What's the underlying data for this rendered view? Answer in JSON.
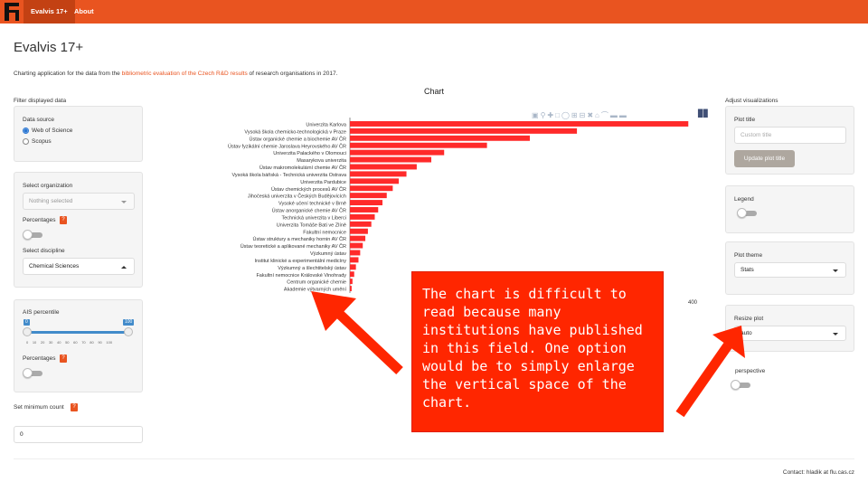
{
  "navbar": {
    "logo_letter": "F",
    "tabs": [
      {
        "label": "Evalvis 17+"
      },
      {
        "label": "About"
      }
    ],
    "color": "#e95420",
    "active_color": "#c34113"
  },
  "page": {
    "title": "Evalvis 17+",
    "intro_before": "Charting application for the data from the ",
    "intro_link": "bibliometric evaluation of the Czech R&D results",
    "intro_after": " of research organisations in 2017."
  },
  "filters": {
    "heading": "Filter displayed data",
    "data_source": {
      "label": "Data source",
      "options": [
        "Web of Science",
        "Scopus"
      ],
      "selected": "Web of Science"
    },
    "organization": {
      "label": "Select organization",
      "placeholder": "Nothing selected"
    },
    "percentages_label": "Percentages",
    "help_glyph": "?",
    "discipline": {
      "label": "Select discipline",
      "value": "Chemical Sciences"
    },
    "ais": {
      "label": "AIS percentile",
      "min": "0",
      "max": "100",
      "ticks": "0 10 20 30 40 50 60 70 80 90 100"
    },
    "percentages2_label": "Percentages",
    "min_count": {
      "label": "Set minimum count",
      "value": "0"
    }
  },
  "chart": {
    "title": "Chart",
    "modebar_icons": [
      "camera-icon",
      "zoom-icon",
      "pan-icon",
      "box-select-icon",
      "lasso-icon",
      "zoom-in-icon",
      "zoom-out-icon",
      "autoscale-icon",
      "reset-axes-icon",
      "spike-lines-icon",
      "hover-closest-icon",
      "hover-compare-icon",
      "plotly-logo-icon"
    ]
  },
  "chart_data": {
    "type": "bar",
    "orientation": "horizontal",
    "title": "",
    "xlabel": "",
    "ylabel": "",
    "xlim": [
      0,
      400
    ],
    "x_tick_labels": [
      "400"
    ],
    "bar_color": "#ff2a2a",
    "categories": [
      "Univerzita Karlova",
      "Vysoká škola chemicko-technologická v Praze",
      "Ústav organické chemie a biochemie AV ČR",
      "Ústav fyzikální chemie Jaroslava Heyrovského AV ČR",
      "Univerzita Palackého v Olomouci",
      "Masarykova univerzita",
      "Ústav makromolekulární chemie AV ČR",
      "Vysoká škola báňská - Technická univerzita Ostrava",
      "Univerzita Pardubice",
      "Ústav chemických procesů AV ČR",
      "Jihočeská univerzita v Českých Budějovicích",
      "Vysoké učení technické v Brně",
      "Ústav anorganické chemie AV ČR",
      "Technická univerzita v Liberci",
      "Univerzita Tomáše Bati ve Zlíně",
      "Fakultní nemocnice",
      "Ústav struktury a mechaniky hornin AV ČR",
      "Ústav teoretické a aplikované mechaniky AV ČR",
      "Výzkumný ústav",
      "Institut klinické a experimentální medicíny",
      "Výzkumný a šlechtitelský ústav",
      "Fakultní nemocnice Královské Vinohrady",
      "Centrum organické chemie",
      "Akademie výtvarných umění"
    ],
    "values": [
      395,
      265,
      210,
      160,
      110,
      95,
      78,
      66,
      57,
      50,
      43,
      38,
      33,
      29,
      25,
      21,
      18,
      15,
      12,
      10,
      7,
      5,
      3,
      2
    ]
  },
  "adjust": {
    "heading": "Adjust visualizations",
    "plot_title": {
      "label": "Plot title",
      "placeholder": "Custom title",
      "button": "Update plot title"
    },
    "legend_label": "Legend",
    "theme": {
      "label": "Plot theme",
      "value": "Stats"
    },
    "resize": {
      "label": "Resize plot",
      "value": "auto"
    },
    "perspective_label": "perspective"
  },
  "callout": {
    "text": "The chart is difficult to read because many institutions have published in this field. One option would be to simply enlarge the vertical space of the chart.",
    "color": "#ff2600"
  },
  "footer": {
    "contact": "Contact: hladik at flu.cas.cz"
  }
}
